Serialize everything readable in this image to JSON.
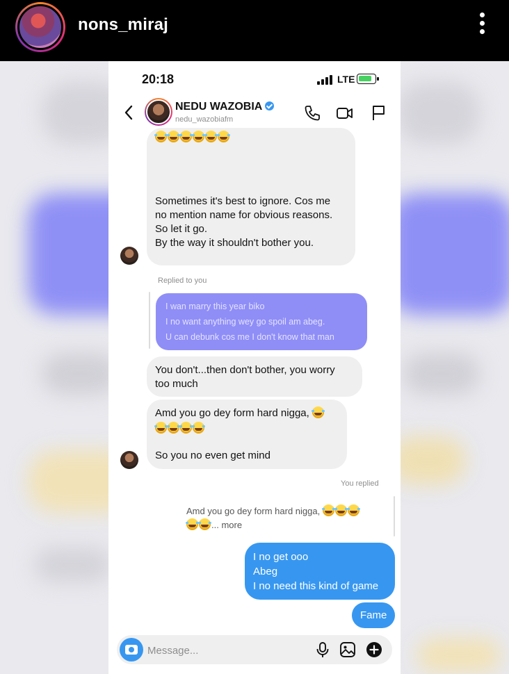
{
  "story": {
    "username": "nons_miraj",
    "accent_gradient": [
      "#f58529",
      "#dd2a7b",
      "#8134af"
    ]
  },
  "status_bar": {
    "time": "20:18",
    "network": "LTE",
    "battery_color": "#46d160"
  },
  "chat": {
    "name": "NEDU WAZOBIA",
    "handle": "nedu_wazobiafm",
    "verified": true,
    "header_icons": [
      "back-icon",
      "phone-icon",
      "video-icon",
      "flag-icon"
    ]
  },
  "messages": {
    "first": {
      "lines": [
        "Sometimes it's best to ignore. Cos me",
        "no mention name for obvious reasons.",
        "So let it go.",
        "By the way it shouldn't bother you."
      ]
    },
    "replied_to_you": "Replied to you",
    "quoted": [
      "I wan marry this year biko",
      "I no want anything wey go spoil am abeg.",
      "U can debunk cos me I don't know that man"
    ],
    "dont_bother": {
      "line1": "You don't...then don't bother, you worry",
      "line2": "too much"
    },
    "amd": {
      "text": "Amd you go dey form hard nigga,",
      "line2": "So you no even get mind"
    },
    "you_replied": "You replied",
    "own_quote": {
      "text": "Amd you go dey form hard nigga,",
      "more": "... more"
    },
    "out": [
      "I no get ooo",
      "Abeg",
      "I no need this kind of game"
    ],
    "fame": "Fame"
  },
  "composer": {
    "placeholder": "Message...",
    "accent": "#3797f0"
  }
}
